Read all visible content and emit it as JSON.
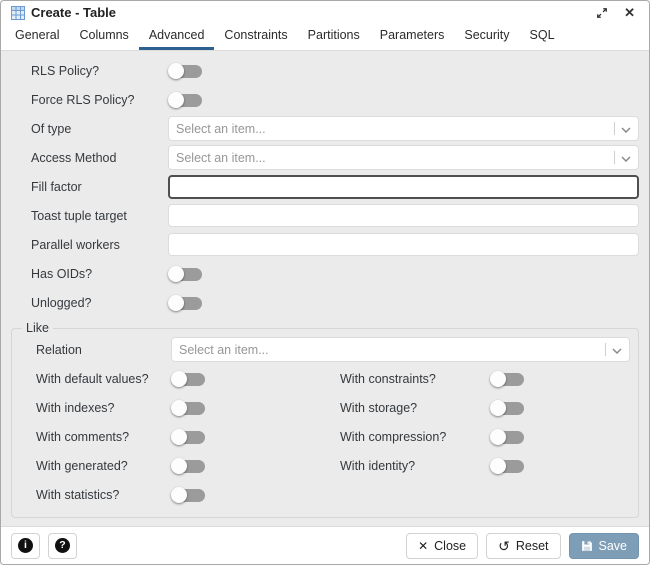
{
  "window": {
    "title": "Create - Table",
    "icons": {
      "maximize": "maximize-icon",
      "close_glyph": "✕",
      "table": "table-grid-icon"
    }
  },
  "tabs": {
    "active": "Advanced",
    "items": [
      "General",
      "Columns",
      "Advanced",
      "Constraints",
      "Partitions",
      "Parameters",
      "Security",
      "SQL"
    ]
  },
  "fields": {
    "rls_policy": {
      "label": "RLS Policy?",
      "value": false
    },
    "force_rls_policy": {
      "label": "Force RLS Policy?",
      "value": false
    },
    "of_type": {
      "label": "Of type",
      "value": "Select an item..."
    },
    "access_method": {
      "label": "Access Method",
      "value": "Select an item..."
    },
    "fill_factor": {
      "label": "Fill factor",
      "value": "",
      "focused": true
    },
    "toast_tuple_target": {
      "label": "Toast tuple target",
      "value": ""
    },
    "parallel_workers": {
      "label": "Parallel workers",
      "value": ""
    },
    "has_oids": {
      "label": "Has OIDs?",
      "value": false
    },
    "unlogged": {
      "label": "Unlogged?",
      "value": false
    }
  },
  "like": {
    "legend": "Like",
    "relation": {
      "label": "Relation",
      "value": "Select an item..."
    },
    "toggles": {
      "with_default_values": {
        "label": "With default values?",
        "value": false
      },
      "with_constraints": {
        "label": "With constraints?",
        "value": false
      },
      "with_indexes": {
        "label": "With indexes?",
        "value": false
      },
      "with_storage": {
        "label": "With storage?",
        "value": false
      },
      "with_comments": {
        "label": "With comments?",
        "value": false
      },
      "with_compression": {
        "label": "With compression?",
        "value": false
      },
      "with_generated": {
        "label": "With generated?",
        "value": false
      },
      "with_identity": {
        "label": "With identity?",
        "value": false
      },
      "with_statistics": {
        "label": "With statistics?",
        "value": false
      }
    }
  },
  "footer": {
    "info_glyph": "i",
    "help_glyph": "?",
    "close_glyph": "✕",
    "reset_glyph": "↺",
    "close": "Close",
    "reset": "Reset",
    "save": "Save"
  },
  "colors": {
    "accent": "#2c6090",
    "save_button": "#7e9db7",
    "toggle_track": "#9b9b9b",
    "content_bg": "#ebebeb"
  }
}
